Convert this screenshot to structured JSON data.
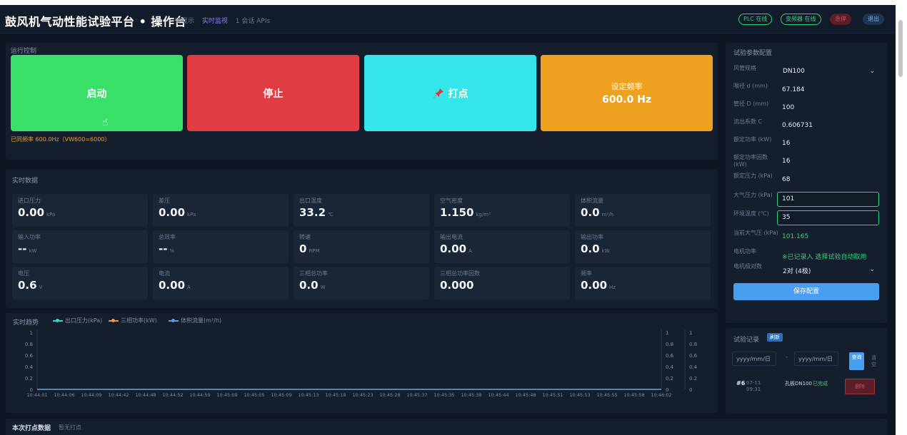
{
  "header": {
    "title": "鼓风机气动性能试验平台 • 操作台",
    "links": [
      "一键显示",
      "实时监视",
      "1 会话 APIs"
    ],
    "badges": {
      "plc": "PLC 在线",
      "inverter": "变频器 在线",
      "stop": "急停",
      "settings": "退出"
    }
  },
  "control": {
    "title": "运行控制",
    "start": "启动",
    "stop": "停止",
    "mark_icon": "pin-icon",
    "mark": "打点",
    "freq_label": "设定频率",
    "freq_value": "600.0 Hz",
    "note": "已同频率 600.0Hz（VW600=6000）"
  },
  "realtime": {
    "title": "实时数据",
    "metrics": [
      {
        "label": "进口压力",
        "value": "0.00",
        "unit": "kPa"
      },
      {
        "label": "差压",
        "value": "0.00",
        "unit": "kPa"
      },
      {
        "label": "出口温度",
        "value": "33.2",
        "unit": "℃"
      },
      {
        "label": "空气密度",
        "value": "1.150",
        "unit": "kg/m³"
      },
      {
        "label": "体积流量",
        "value": "0.0",
        "unit": "m³/h"
      },
      {
        "label": "输入功率",
        "value": "--",
        "unit": "kW"
      },
      {
        "label": "总效率",
        "value": "--",
        "unit": "%"
      },
      {
        "label": "转速",
        "value": "0",
        "unit": "RPM"
      },
      {
        "label": "输出电流",
        "value": "0.00",
        "unit": "A"
      },
      {
        "label": "输出功率",
        "value": "0.0",
        "unit": "kW"
      },
      {
        "label": "电压",
        "value": "0.6",
        "unit": "V"
      },
      {
        "label": "电流",
        "value": "0.00",
        "unit": "A"
      },
      {
        "label": "三相总功率",
        "value": "0.0",
        "unit": "W"
      },
      {
        "label": "三相总功率因数",
        "value": "0.000",
        "unit": ""
      },
      {
        "label": "频率",
        "value": "0.00",
        "unit": "Hz"
      }
    ]
  },
  "chart_data": {
    "type": "line",
    "title": "实时趋势",
    "series": [
      {
        "name": "出口压力(kPa)",
        "color": "#37d1c4",
        "values": [
          0,
          0,
          0,
          0,
          0,
          0,
          0,
          0,
          0,
          0,
          0,
          0,
          0,
          0,
          0,
          0,
          0,
          0,
          0,
          0,
          0,
          0,
          0,
          0,
          0
        ]
      },
      {
        "name": "三相功率(kW)",
        "color": "#e8934a",
        "values": [
          0,
          0,
          0,
          0,
          0,
          0,
          0,
          0,
          0,
          0,
          0,
          0,
          0,
          0,
          0,
          0,
          0,
          0,
          0,
          0,
          0,
          0,
          0,
          0,
          0
        ]
      },
      {
        "name": "体积流量(m³/h)",
        "color": "#5a9de8",
        "values": [
          0,
          0,
          0,
          0,
          0,
          0,
          0,
          0,
          0,
          0,
          0,
          0,
          0,
          0,
          0,
          0,
          0,
          0,
          0,
          0,
          0,
          0,
          0,
          0,
          0
        ]
      }
    ],
    "x": [
      "10:44:01",
      "10:44:06",
      "10:44:09",
      "10:44:42",
      "10:44:48",
      "10:44:52",
      "10:44:59",
      "10:45:09",
      "10:45:05",
      "10:45:09",
      "10:45:13",
      "10:45:18",
      "10:45:23",
      "10:45:28",
      "10:45:37",
      "10:45:35",
      "10:45:38",
      "10:45:44",
      "10:45:48",
      "10:45:51",
      "10:45:53",
      "10:45:55",
      "10:45:58",
      "10:46:02"
    ],
    "yticks": [
      "0",
      "0.2",
      "0.4",
      "0.6",
      "0.8",
      "1"
    ],
    "ylim": [
      0,
      1
    ],
    "grid": false
  },
  "config": {
    "title": "试验参数配置",
    "rows": [
      {
        "label": "风管规格",
        "value": "DN100",
        "kind": "select"
      },
      {
        "label": "喉径 d (mm)",
        "value": "67.184",
        "kind": "text"
      },
      {
        "label": "管径 D (mm)",
        "value": "100",
        "kind": "text"
      },
      {
        "label": "流出系数 C",
        "value": "0.606731",
        "kind": "text"
      },
      {
        "label": "额定功率 (kW)",
        "value": "16",
        "kind": "text"
      },
      {
        "label": "额定功率因数 (kW)",
        "value": "16",
        "kind": "text"
      },
      {
        "label": "额定压力 (kPa)",
        "value": "68",
        "kind": "text"
      },
      {
        "label": "大气压力 (kPa)",
        "value": "101",
        "kind": "input"
      },
      {
        "label": "环境温度 (℃)",
        "value": "35",
        "kind": "input"
      },
      {
        "label": "当前大气压 (kPa)",
        "value": "101.165",
        "kind": "green"
      },
      {
        "label": "电机功率",
        "value": "※已记录入   选择试验自动取用",
        "kind": "green"
      },
      {
        "label": "电机极对数",
        "value": "2对 (4极)",
        "kind": "select"
      }
    ],
    "save": "保存配置"
  },
  "records": {
    "title": "试验记录",
    "badge": "刷新",
    "date_placeholder": "yyyy/mm/日",
    "date_sep": "-",
    "query": "查询",
    "clear": "清空",
    "item": {
      "no": "#6",
      "time": "07-11 09:31",
      "desc": "孔板DN100",
      "status": "已完成",
      "action": "删除"
    }
  },
  "footer": {
    "title": "本次打点数据",
    "sub": "暂无打点"
  }
}
